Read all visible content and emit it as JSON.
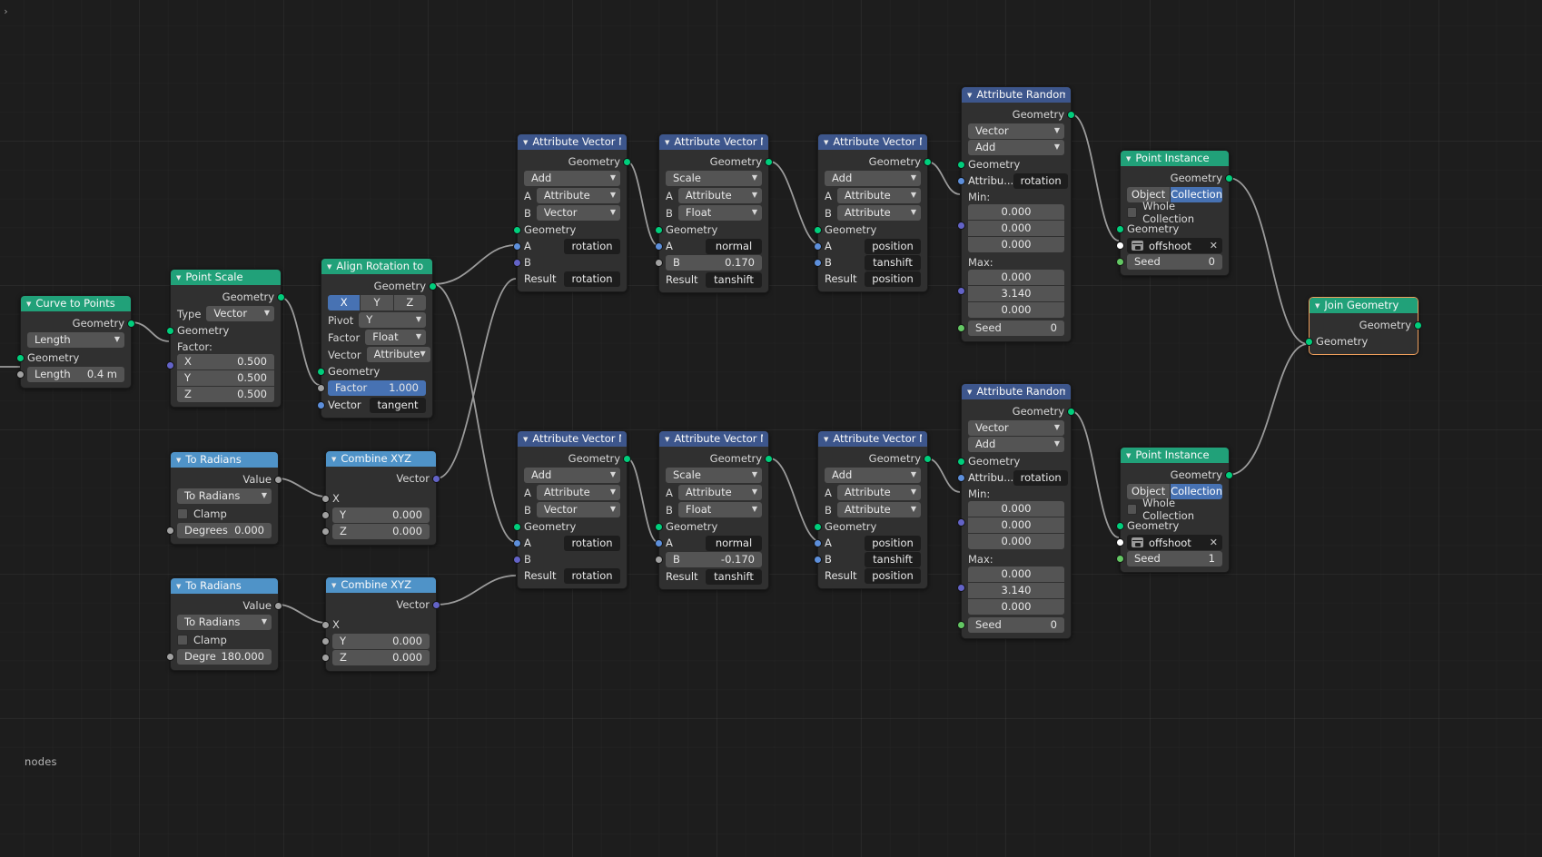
{
  "editor": {
    "corner_glyph": "›",
    "breadcrumb": "nodes"
  },
  "colors": {
    "geometry_header": "#21a179",
    "attribute_header": "#3d568c",
    "converter_header": "#4f93c8",
    "selected_outline": "#ed9e5c",
    "active_widget": "#4772b3",
    "geometry_socket": "#00ce7c",
    "vector_socket": "#6363c7",
    "float_socket": "#a1a1a1",
    "blue_socket": "#5d8fdb",
    "background": "#1d1d1d"
  },
  "nodes": {
    "curve_to_points": {
      "title": "Curve to Points",
      "out_geometry": "Geometry",
      "mode": "Length",
      "in_geometry": "Geometry",
      "length_label": "Length",
      "length_value": "0.4 m"
    },
    "point_scale": {
      "title": "Point Scale",
      "out_geometry": "Geometry",
      "type_label": "Type",
      "type_value": "Vector",
      "in_geometry": "Geometry",
      "factor_label": "Factor:",
      "x_label": "X",
      "x_value": "0.500",
      "y_label": "Y",
      "y_value": "0.500",
      "z_label": "Z",
      "z_value": "0.500"
    },
    "align_rotation": {
      "title": "Align Rotation to Ve...",
      "out_geometry": "Geometry",
      "axis_x": "X",
      "axis_y": "Y",
      "axis_z": "Z",
      "pivot_label": "Pivot",
      "pivot_value": "Y",
      "factor_label": "Factor",
      "factor_value": "Float",
      "vector_label": "Vector",
      "vector_value": "Attribute",
      "in_geometry": "Geometry",
      "factor_field_label": "Factor",
      "factor_field_value": "1.000",
      "vector_field_label": "Vector",
      "vector_field_value": "tangent"
    },
    "to_radians_top": {
      "title": "To Radians",
      "out_value": "Value",
      "operation": "To Radians",
      "clamp_label": "Clamp",
      "deg_label": "Degrees",
      "deg_value": "0.000"
    },
    "to_radians_bottom": {
      "title": "To Radians",
      "out_value": "Value",
      "operation": "To Radians",
      "clamp_label": "Clamp",
      "deg_label": "Degre",
      "deg_value": "180.000"
    },
    "combine_xyz_top": {
      "title": "Combine XYZ",
      "out_vector": "Vector",
      "x_label": "X",
      "y_label": "Y",
      "y_value": "0.000",
      "z_label": "Z",
      "z_value": "0.000"
    },
    "combine_xyz_bottom": {
      "title": "Combine XYZ",
      "out_vector": "Vector",
      "x_label": "X",
      "y_label": "Y",
      "y_value": "0.000",
      "z_label": "Z",
      "z_value": "0.000"
    },
    "avm_add_top": {
      "title": "Attribute Vector Mat",
      "out_geometry": "Geometry",
      "operation": "Add",
      "a_label": "A",
      "a_type": "Attribute",
      "b_label": "B",
      "b_type": "Vector",
      "in_geometry": "Geometry",
      "in_a_label": "A",
      "in_a_value": "rotation",
      "in_b_label": "B",
      "result_label": "Result",
      "result_value": "rotation"
    },
    "avm_scale_top": {
      "title": "Attribute Vector Mat",
      "out_geometry": "Geometry",
      "operation": "Scale",
      "a_label": "A",
      "a_type": "Attribute",
      "b_label": "B",
      "b_type": "Float",
      "in_geometry": "Geometry",
      "in_a_label": "A",
      "in_a_value": "normal",
      "in_b_label": "B",
      "in_b_value": "0.170",
      "result_label": "Result",
      "result_value": "tanshift"
    },
    "avm_add2_top": {
      "title": "Attribute Vector Mat",
      "out_geometry": "Geometry",
      "operation": "Add",
      "a_label": "A",
      "a_type": "Attribute",
      "b_label": "B",
      "b_type": "Attribute",
      "in_geometry": "Geometry",
      "in_a_label": "A",
      "in_a_value": "position",
      "in_b_label": "B",
      "in_b_value": "tanshift",
      "result_label": "Result",
      "result_value": "position"
    },
    "avm_add_bottom": {
      "title": "Attribute Vector Mat",
      "out_geometry": "Geometry",
      "operation": "Add",
      "a_label": "A",
      "a_type": "Attribute",
      "b_label": "B",
      "b_type": "Vector",
      "in_geometry": "Geometry",
      "in_a_label": "A",
      "in_a_value": "rotation",
      "in_b_label": "B",
      "result_label": "Result",
      "result_value": "rotation"
    },
    "avm_scale_bottom": {
      "title": "Attribute Vector Mat",
      "out_geometry": "Geometry",
      "operation": "Scale",
      "a_label": "A",
      "a_type": "Attribute",
      "b_label": "B",
      "b_type": "Float",
      "in_geometry": "Geometry",
      "in_a_label": "A",
      "in_a_value": "normal",
      "in_b_label": "B",
      "in_b_value": "-0.170",
      "result_label": "Result",
      "result_value": "tanshift"
    },
    "avm_add2_bottom": {
      "title": "Attribute Vector Mat",
      "out_geometry": "Geometry",
      "operation": "Add",
      "a_label": "A",
      "a_type": "Attribute",
      "b_label": "B",
      "b_type": "Attribute",
      "in_geometry": "Geometry",
      "in_a_label": "A",
      "in_a_value": "position",
      "in_b_label": "B",
      "in_b_value": "tanshift",
      "result_label": "Result",
      "result_value": "position"
    },
    "randomize_top": {
      "title": "Attribute Randomize",
      "out_geometry": "Geometry",
      "data_type": "Vector",
      "operation": "Add",
      "in_geometry": "Geometry",
      "attribute_label": "Attribu...",
      "attribute_value": "rotation",
      "min_label": "Min:",
      "min_x": "0.000",
      "min_y": "0.000",
      "min_z": "0.000",
      "max_label": "Max:",
      "max_x": "0.000",
      "max_y": "3.140",
      "max_z": "0.000",
      "seed_label": "Seed",
      "seed_value": "0"
    },
    "randomize_bottom": {
      "title": "Attribute Randomize",
      "out_geometry": "Geometry",
      "data_type": "Vector",
      "operation": "Add",
      "in_geometry": "Geometry",
      "attribute_label": "Attribu...",
      "attribute_value": "rotation",
      "min_label": "Min:",
      "min_x": "0.000",
      "min_y": "0.000",
      "min_z": "0.000",
      "max_label": "Max:",
      "max_x": "0.000",
      "max_y": "3.140",
      "max_z": "0.000",
      "seed_label": "Seed",
      "seed_value": "0"
    },
    "point_instance_top": {
      "title": "Point Instance",
      "out_geometry": "Geometry",
      "mode_object": "Object",
      "mode_collection": "Collection",
      "whole_collection": "Whole Collection",
      "in_geometry": "Geometry",
      "collection_name": "offshoot",
      "seed_label": "Seed",
      "seed_value": "0"
    },
    "point_instance_bottom": {
      "title": "Point Instance",
      "out_geometry": "Geometry",
      "mode_object": "Object",
      "mode_collection": "Collection",
      "whole_collection": "Whole Collection",
      "in_geometry": "Geometry",
      "collection_name": "offshoot",
      "seed_label": "Seed",
      "seed_value": "1"
    },
    "join_geometry": {
      "title": "Join Geometry",
      "out_geometry": "Geometry",
      "in_geometry": "Geometry"
    }
  }
}
